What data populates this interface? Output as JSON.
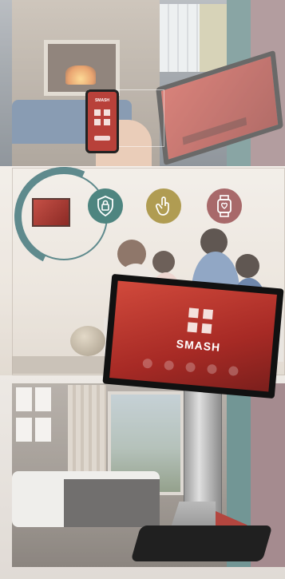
{
  "phone": {
    "brand": "SMASH"
  },
  "device": {
    "brand": "SMASH"
  },
  "icons": [
    "lock-icon",
    "touch-icon",
    "smartwatch-icon"
  ],
  "colors": {
    "teal": "#4f7c7b",
    "mauve": "#8f6f73",
    "mustard": "#b09c52",
    "accent_red": "#c8453b"
  }
}
